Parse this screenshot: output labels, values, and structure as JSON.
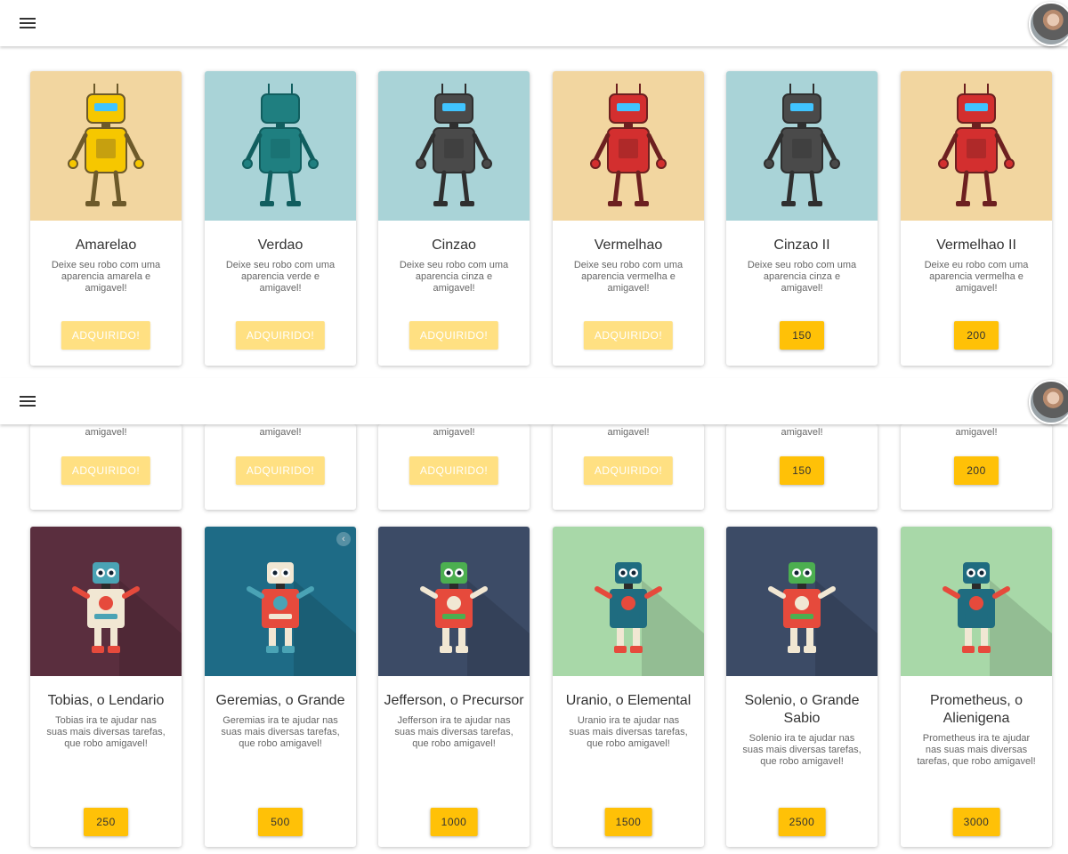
{
  "colors": {
    "accent": "#ffc107",
    "acquired": "#ffe082",
    "appbar": "#ffffff"
  },
  "icons": {
    "menu": "menu-icon",
    "avatar": "avatar"
  },
  "top_cards": [
    {
      "name": "Amarelao",
      "desc": "Deixe seu robo com uma aparencia amarela e amigavel!",
      "button": "ADQUIRIDO!",
      "acquired": true,
      "bg": "#f2d6a0"
    },
    {
      "name": "Verdao",
      "desc": "Deixe seu robo com uma aparencia verde e amigavel!",
      "button": "ADQUIRIDO!",
      "acquired": true,
      "bg": "#a9d3d7"
    },
    {
      "name": "Cinzao",
      "desc": "Deixe seu robo com uma aparencia cinza e amigavel!",
      "button": "ADQUIRIDO!",
      "acquired": true,
      "bg": "#a9d3d7"
    },
    {
      "name": "Vermelhao",
      "desc": "Deixe seu robo com uma aparencia vermelha e amigavel!",
      "button": "ADQUIRIDO!",
      "acquired": true,
      "bg": "#f2d6a0"
    },
    {
      "name": "Cinzao II",
      "desc": "Deixe seu robo com uma aparencia cinza e amigavel!",
      "button": "150",
      "acquired": false,
      "bg": "#a9d3d7"
    },
    {
      "name": "Vermelhao II",
      "desc": "Deixe eu robo com uma aparencia vermelha e amigavel!",
      "button": "200",
      "acquired": false,
      "bg": "#f2d6a0"
    }
  ],
  "partial_row": {
    "text": "amigavel!",
    "buttons": [
      "ADQUIRIDO!",
      "ADQUIRIDO!",
      "ADQUIRIDO!",
      "ADQUIRIDO!",
      "150",
      "200"
    ],
    "acquired": [
      true,
      true,
      true,
      true,
      false,
      false
    ]
  },
  "bottom_cards": [
    {
      "name": "Tobias, o Lendario",
      "desc": "Tobias ira te ajudar nas suas mais diversas tarefas, que robo amigavel!",
      "button": "250",
      "bg": "#5a2e3e"
    },
    {
      "name": "Geremias, o Grande",
      "desc": "Geremias ira te ajudar nas suas mais diversas tarefas, que robo amigavel!",
      "button": "500",
      "bg": "#1e6b86"
    },
    {
      "name": "Jefferson, o Precursor",
      "desc": "Jefferson ira te ajudar nas suas mais diversas tarefas, que robo amigavel!",
      "button": "1000",
      "bg": "#3c4b66"
    },
    {
      "name": "Uranio, o Elemental",
      "desc": "Uranio ira te ajudar nas suas mais diversas tarefas, que robo amigavel!",
      "button": "1500",
      "bg": "#a8d8a8"
    },
    {
      "name": "Solenio, o Grande Sabio",
      "desc": "Solenio ira te ajudar nas suas mais diversas tarefas, que robo amigavel!",
      "button": "2500",
      "bg": "#3c4b66"
    },
    {
      "name": "Prometheus, o Alienigena",
      "desc": "Prometheus ira te ajudar nas suas mais diversas tarefas, que robo amigavel!",
      "button": "3000",
      "bg": "#a8d8a8"
    }
  ]
}
